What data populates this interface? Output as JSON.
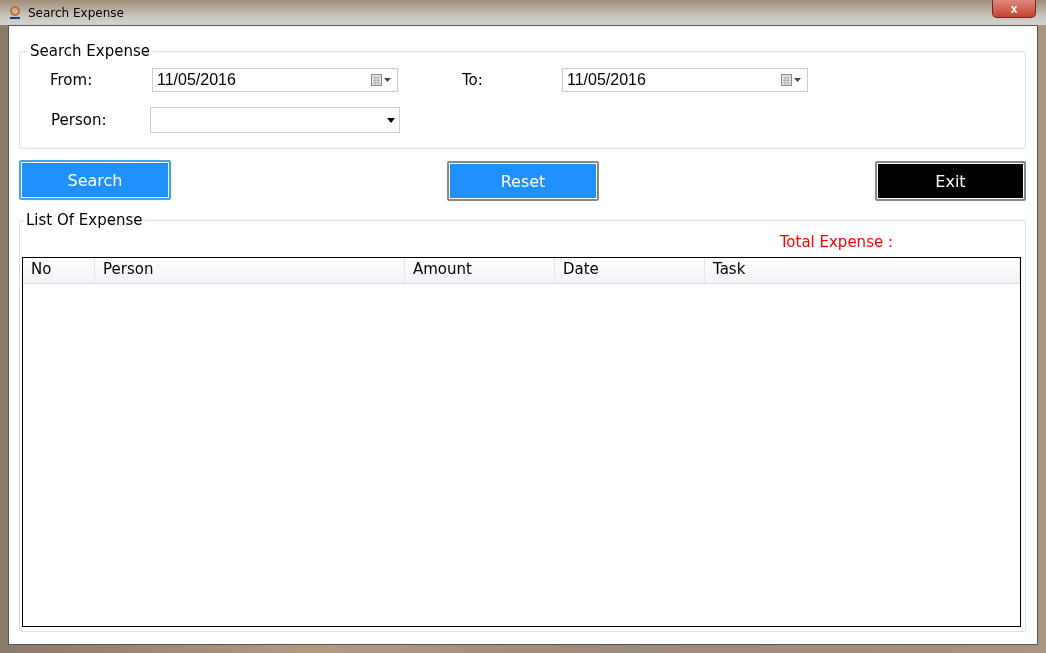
{
  "window": {
    "title": "Search Expense",
    "close": "x"
  },
  "search_panel": {
    "legend": "Search Expense",
    "from_label": "From:",
    "from_value": "11/05/2016",
    "to_label": "To:",
    "to_value": "11/05/2016",
    "person_label": "Person:"
  },
  "buttons": [
    {
      "label": "Search",
      "kind": "focused"
    },
    {
      "label": "Reset",
      "kind": "normal"
    },
    {
      "label": "Exit",
      "kind": "dark"
    }
  ],
  "list_panel": {
    "legend": "List Of Expense",
    "total_label": "Total Expense :"
  },
  "table": {
    "columns": [
      "No",
      "Person",
      "Amount",
      "Date",
      "Task"
    ]
  }
}
